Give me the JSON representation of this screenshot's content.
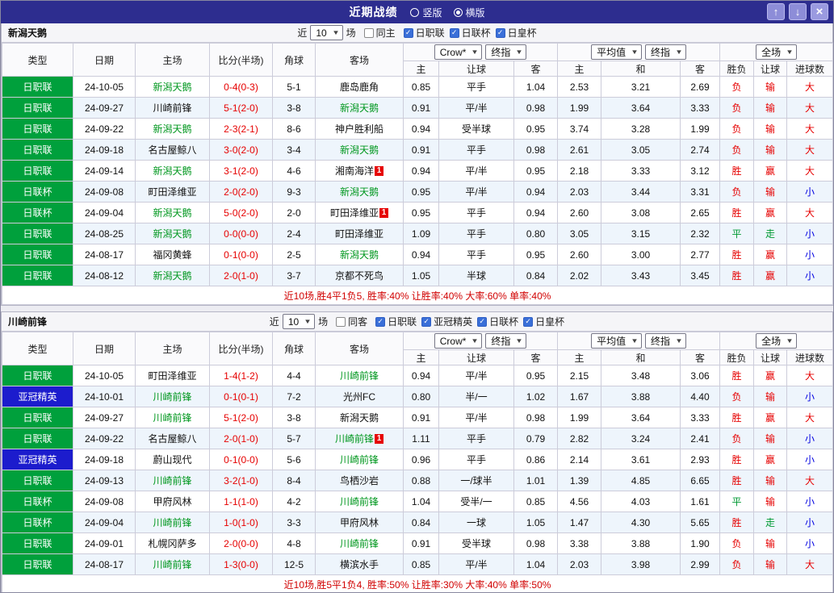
{
  "topbar": {
    "title": "近期战绩",
    "radios": [
      {
        "label": "竖版",
        "selected": false
      },
      {
        "label": "横版",
        "selected": true
      }
    ]
  },
  "icons": {
    "up": "↑",
    "down": "↓",
    "close": "×",
    "dropdown": "▼",
    "check": "✓"
  },
  "colors": {
    "type_bg": {
      "日职联": "#00a03c",
      "日联杯": "#00a03c",
      "亚冠精英": "#1c1ccd"
    },
    "result": {
      "胜": "#e60000",
      "负": "#e60000",
      "平": "#009933",
      "赢": "#e60000",
      "输": "#e60000",
      "走": "#009933",
      "大": "#e60000",
      "小": "#0000e0"
    }
  },
  "table_header": {
    "cols": [
      "类型",
      "日期",
      "主场",
      "比分(半场)",
      "角球",
      "客场"
    ],
    "group1": {
      "selects": [
        "Crow*",
        "终指"
      ],
      "subcols": [
        "主",
        "让球",
        "客"
      ]
    },
    "group2": {
      "selects": [
        "平均值",
        "终指"
      ],
      "subcols": [
        "主",
        "和",
        "客"
      ]
    },
    "group3": {
      "selects": [
        "全场"
      ],
      "subcols": [
        "胜负",
        "让球",
        "进球数"
      ]
    }
  },
  "sections": [
    {
      "team": "新潟天鹅",
      "filter": {
        "near_label": "近",
        "count": "10",
        "games_label": "场",
        "same_label": "同主",
        "same_checked": false,
        "comps": [
          {
            "label": "日职联",
            "checked": true
          },
          {
            "label": "日联杯",
            "checked": true
          },
          {
            "label": "日皇杯",
            "checked": true
          }
        ]
      },
      "rows": [
        {
          "type": "日职联",
          "date": "24-10-05",
          "home": "新潟天鹅",
          "home_focus": true,
          "score": "0-4(0-3)",
          "corner": "5-1",
          "away": "鹿岛鹿角",
          "odds": [
            "0.85",
            "平手",
            "1.04"
          ],
          "avg": [
            "2.53",
            "3.21",
            "2.69"
          ],
          "result": [
            "负",
            "输",
            "大"
          ]
        },
        {
          "type": "日职联",
          "date": "24-09-27",
          "home": "川崎前锋",
          "score": "5-1(2-0)",
          "corner": "3-8",
          "away": "新潟天鹅",
          "away_focus": true,
          "odds": [
            "0.91",
            "平/半",
            "0.98"
          ],
          "avg": [
            "1.99",
            "3.64",
            "3.33"
          ],
          "result": [
            "负",
            "输",
            "大"
          ]
        },
        {
          "type": "日职联",
          "date": "24-09-22",
          "home": "新潟天鹅",
          "home_focus": true,
          "score": "2-3(2-1)",
          "corner": "8-6",
          "away": "神户胜利船",
          "odds": [
            "0.94",
            "受半球",
            "0.95"
          ],
          "avg": [
            "3.74",
            "3.28",
            "1.99"
          ],
          "result": [
            "负",
            "输",
            "大"
          ]
        },
        {
          "type": "日职联",
          "date": "24-09-18",
          "home": "名古屋鲸八",
          "score": "3-0(2-0)",
          "corner": "3-4",
          "away": "新潟天鹅",
          "away_focus": true,
          "odds": [
            "0.91",
            "平手",
            "0.98"
          ],
          "avg": [
            "2.61",
            "3.05",
            "2.74"
          ],
          "result": [
            "负",
            "输",
            "大"
          ]
        },
        {
          "type": "日职联",
          "date": "24-09-14",
          "home": "新潟天鹅",
          "home_focus": true,
          "score": "3-1(2-0)",
          "corner": "4-6",
          "away": "湘南海洋",
          "away_badge": "1",
          "odds": [
            "0.94",
            "平/半",
            "0.95"
          ],
          "avg": [
            "2.18",
            "3.33",
            "3.12"
          ],
          "result": [
            "胜",
            "赢",
            "大"
          ]
        },
        {
          "type": "日联杯",
          "date": "24-09-08",
          "home": "町田泽维亚",
          "score": "2-0(2-0)",
          "corner": "9-3",
          "away": "新潟天鹅",
          "away_focus": true,
          "odds": [
            "0.95",
            "平/半",
            "0.94"
          ],
          "avg": [
            "2.03",
            "3.44",
            "3.31"
          ],
          "result": [
            "负",
            "输",
            "小"
          ]
        },
        {
          "type": "日联杯",
          "date": "24-09-04",
          "home": "新潟天鹅",
          "home_focus": true,
          "score": "5-0(2-0)",
          "corner": "2-0",
          "away": "町田泽维亚",
          "away_badge": "1",
          "odds": [
            "0.95",
            "平手",
            "0.94"
          ],
          "avg": [
            "2.60",
            "3.08",
            "2.65"
          ],
          "result": [
            "胜",
            "赢",
            "大"
          ]
        },
        {
          "type": "日职联",
          "date": "24-08-25",
          "home": "新潟天鹅",
          "home_focus": true,
          "score": "0-0(0-0)",
          "corner": "2-4",
          "away": "町田泽维亚",
          "odds": [
            "1.09",
            "平手",
            "0.80"
          ],
          "avg": [
            "3.05",
            "3.15",
            "2.32"
          ],
          "result": [
            "平",
            "走",
            "小"
          ]
        },
        {
          "type": "日职联",
          "date": "24-08-17",
          "home": "福冈黄蜂",
          "score": "0-1(0-0)",
          "corner": "2-5",
          "away": "新潟天鹅",
          "away_focus": true,
          "odds": [
            "0.94",
            "平手",
            "0.95"
          ],
          "avg": [
            "2.60",
            "3.00",
            "2.77"
          ],
          "result": [
            "胜",
            "赢",
            "小"
          ]
        },
        {
          "type": "日职联",
          "date": "24-08-12",
          "home": "新潟天鹅",
          "home_focus": true,
          "score": "2-0(1-0)",
          "corner": "3-7",
          "away": "京都不死鸟",
          "odds": [
            "1.05",
            "半球",
            "0.84"
          ],
          "avg": [
            "2.02",
            "3.43",
            "3.45"
          ],
          "result": [
            "胜",
            "赢",
            "小"
          ]
        }
      ],
      "summary": "近10场,胜4平1负5, 胜率:40% 让胜率:40% 大率:60% 单率:40%"
    },
    {
      "team": "川崎前锋",
      "filter": {
        "near_label": "近",
        "count": "10",
        "games_label": "场",
        "same_label": "同客",
        "same_checked": false,
        "comps": [
          {
            "label": "日职联",
            "checked": true
          },
          {
            "label": "亚冠精英",
            "checked": true
          },
          {
            "label": "日联杯",
            "checked": true
          },
          {
            "label": "日皇杯",
            "checked": true
          }
        ]
      },
      "rows": [
        {
          "type": "日职联",
          "date": "24-10-05",
          "home": "町田泽维亚",
          "score": "1-4(1-2)",
          "corner": "4-4",
          "away": "川崎前锋",
          "away_focus": true,
          "odds": [
            "0.94",
            "平/半",
            "0.95"
          ],
          "avg": [
            "2.15",
            "3.48",
            "3.06"
          ],
          "result": [
            "胜",
            "赢",
            "大"
          ]
        },
        {
          "type": "亚冠精英",
          "date": "24-10-01",
          "home": "川崎前锋",
          "home_focus": true,
          "score": "0-1(0-1)",
          "corner": "7-2",
          "away": "光州FC",
          "odds": [
            "0.80",
            "半/一",
            "1.02"
          ],
          "avg": [
            "1.67",
            "3.88",
            "4.40"
          ],
          "result": [
            "负",
            "输",
            "小"
          ]
        },
        {
          "type": "日职联",
          "date": "24-09-27",
          "home": "川崎前锋",
          "home_focus": true,
          "score": "5-1(2-0)",
          "corner": "3-8",
          "away": "新潟天鹅",
          "odds": [
            "0.91",
            "平/半",
            "0.98"
          ],
          "avg": [
            "1.99",
            "3.64",
            "3.33"
          ],
          "result": [
            "胜",
            "赢",
            "大"
          ]
        },
        {
          "type": "日职联",
          "date": "24-09-22",
          "home": "名古屋鲸八",
          "score": "2-0(1-0)",
          "corner": "5-7",
          "away": "川崎前锋",
          "away_focus": true,
          "away_badge": "1",
          "odds": [
            "1.11",
            "平手",
            "0.79"
          ],
          "avg": [
            "2.82",
            "3.24",
            "2.41"
          ],
          "result": [
            "负",
            "输",
            "小"
          ]
        },
        {
          "type": "亚冠精英",
          "date": "24-09-18",
          "home": "蔚山现代",
          "score": "0-1(0-0)",
          "corner": "5-6",
          "away": "川崎前锋",
          "away_focus": true,
          "odds": [
            "0.96",
            "平手",
            "0.86"
          ],
          "avg": [
            "2.14",
            "3.61",
            "2.93"
          ],
          "result": [
            "胜",
            "赢",
            "小"
          ]
        },
        {
          "type": "日职联",
          "date": "24-09-13",
          "home": "川崎前锋",
          "home_focus": true,
          "score": "3-2(1-0)",
          "corner": "8-4",
          "away": "鸟栖沙岩",
          "odds": [
            "0.88",
            "一/球半",
            "1.01"
          ],
          "avg": [
            "1.39",
            "4.85",
            "6.65"
          ],
          "result": [
            "胜",
            "输",
            "大"
          ]
        },
        {
          "type": "日联杯",
          "date": "24-09-08",
          "home": "甲府风林",
          "score": "1-1(1-0)",
          "corner": "4-2",
          "away": "川崎前锋",
          "away_focus": true,
          "odds": [
            "1.04",
            "受半/一",
            "0.85"
          ],
          "avg": [
            "4.56",
            "4.03",
            "1.61"
          ],
          "result": [
            "平",
            "输",
            "小"
          ]
        },
        {
          "type": "日联杯",
          "date": "24-09-04",
          "home": "川崎前锋",
          "home_focus": true,
          "score": "1-0(1-0)",
          "corner": "3-3",
          "away": "甲府风林",
          "odds": [
            "0.84",
            "一球",
            "1.05"
          ],
          "avg": [
            "1.47",
            "4.30",
            "5.65"
          ],
          "result": [
            "胜",
            "走",
            "小"
          ]
        },
        {
          "type": "日职联",
          "date": "24-09-01",
          "home": "札幌冈萨多",
          "score": "2-0(0-0)",
          "corner": "4-8",
          "away": "川崎前锋",
          "away_focus": true,
          "odds": [
            "0.91",
            "受半球",
            "0.98"
          ],
          "avg": [
            "3.38",
            "3.88",
            "1.90"
          ],
          "result": [
            "负",
            "输",
            "小"
          ]
        },
        {
          "type": "日职联",
          "date": "24-08-17",
          "home": "川崎前锋",
          "home_focus": true,
          "score": "1-3(0-0)",
          "corner": "12-5",
          "away": "横滨水手",
          "odds": [
            "0.85",
            "平/半",
            "1.04"
          ],
          "avg": [
            "2.03",
            "3.98",
            "2.99"
          ],
          "result": [
            "负",
            "输",
            "大"
          ]
        }
      ],
      "summary": "近10场,胜5平1负4, 胜率:50% 让胜率:30% 大率:40% 单率:50%"
    }
  ]
}
